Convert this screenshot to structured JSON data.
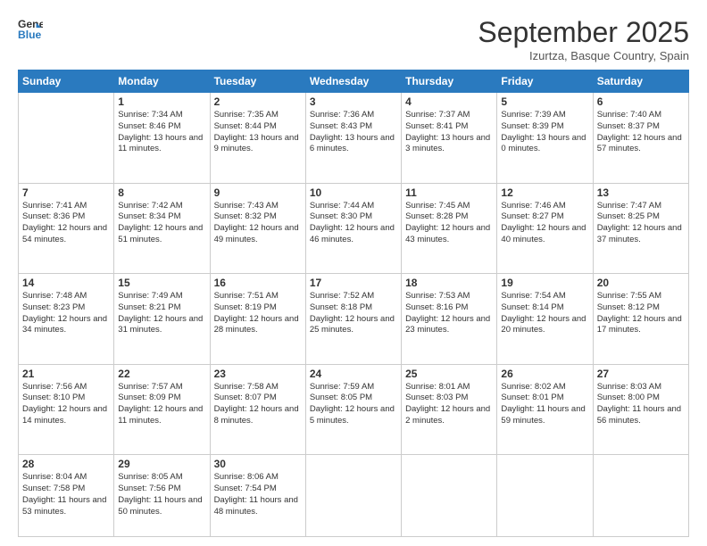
{
  "header": {
    "logo_general": "General",
    "logo_blue": "Blue",
    "month_title": "September 2025",
    "subtitle": "Izurtza, Basque Country, Spain"
  },
  "days_of_week": [
    "Sunday",
    "Monday",
    "Tuesday",
    "Wednesday",
    "Thursday",
    "Friday",
    "Saturday"
  ],
  "weeks": [
    [
      {
        "day": "",
        "sunrise": "",
        "sunset": "",
        "daylight": ""
      },
      {
        "day": "1",
        "sunrise": "Sunrise: 7:34 AM",
        "sunset": "Sunset: 8:46 PM",
        "daylight": "Daylight: 13 hours and 11 minutes."
      },
      {
        "day": "2",
        "sunrise": "Sunrise: 7:35 AM",
        "sunset": "Sunset: 8:44 PM",
        "daylight": "Daylight: 13 hours and 9 minutes."
      },
      {
        "day": "3",
        "sunrise": "Sunrise: 7:36 AM",
        "sunset": "Sunset: 8:43 PM",
        "daylight": "Daylight: 13 hours and 6 minutes."
      },
      {
        "day": "4",
        "sunrise": "Sunrise: 7:37 AM",
        "sunset": "Sunset: 8:41 PM",
        "daylight": "Daylight: 13 hours and 3 minutes."
      },
      {
        "day": "5",
        "sunrise": "Sunrise: 7:39 AM",
        "sunset": "Sunset: 8:39 PM",
        "daylight": "Daylight: 13 hours and 0 minutes."
      },
      {
        "day": "6",
        "sunrise": "Sunrise: 7:40 AM",
        "sunset": "Sunset: 8:37 PM",
        "daylight": "Daylight: 12 hours and 57 minutes."
      }
    ],
    [
      {
        "day": "7",
        "sunrise": "Sunrise: 7:41 AM",
        "sunset": "Sunset: 8:36 PM",
        "daylight": "Daylight: 12 hours and 54 minutes."
      },
      {
        "day": "8",
        "sunrise": "Sunrise: 7:42 AM",
        "sunset": "Sunset: 8:34 PM",
        "daylight": "Daylight: 12 hours and 51 minutes."
      },
      {
        "day": "9",
        "sunrise": "Sunrise: 7:43 AM",
        "sunset": "Sunset: 8:32 PM",
        "daylight": "Daylight: 12 hours and 49 minutes."
      },
      {
        "day": "10",
        "sunrise": "Sunrise: 7:44 AM",
        "sunset": "Sunset: 8:30 PM",
        "daylight": "Daylight: 12 hours and 46 minutes."
      },
      {
        "day": "11",
        "sunrise": "Sunrise: 7:45 AM",
        "sunset": "Sunset: 8:28 PM",
        "daylight": "Daylight: 12 hours and 43 minutes."
      },
      {
        "day": "12",
        "sunrise": "Sunrise: 7:46 AM",
        "sunset": "Sunset: 8:27 PM",
        "daylight": "Daylight: 12 hours and 40 minutes."
      },
      {
        "day": "13",
        "sunrise": "Sunrise: 7:47 AM",
        "sunset": "Sunset: 8:25 PM",
        "daylight": "Daylight: 12 hours and 37 minutes."
      }
    ],
    [
      {
        "day": "14",
        "sunrise": "Sunrise: 7:48 AM",
        "sunset": "Sunset: 8:23 PM",
        "daylight": "Daylight: 12 hours and 34 minutes."
      },
      {
        "day": "15",
        "sunrise": "Sunrise: 7:49 AM",
        "sunset": "Sunset: 8:21 PM",
        "daylight": "Daylight: 12 hours and 31 minutes."
      },
      {
        "day": "16",
        "sunrise": "Sunrise: 7:51 AM",
        "sunset": "Sunset: 8:19 PM",
        "daylight": "Daylight: 12 hours and 28 minutes."
      },
      {
        "day": "17",
        "sunrise": "Sunrise: 7:52 AM",
        "sunset": "Sunset: 8:18 PM",
        "daylight": "Daylight: 12 hours and 25 minutes."
      },
      {
        "day": "18",
        "sunrise": "Sunrise: 7:53 AM",
        "sunset": "Sunset: 8:16 PM",
        "daylight": "Daylight: 12 hours and 23 minutes."
      },
      {
        "day": "19",
        "sunrise": "Sunrise: 7:54 AM",
        "sunset": "Sunset: 8:14 PM",
        "daylight": "Daylight: 12 hours and 20 minutes."
      },
      {
        "day": "20",
        "sunrise": "Sunrise: 7:55 AM",
        "sunset": "Sunset: 8:12 PM",
        "daylight": "Daylight: 12 hours and 17 minutes."
      }
    ],
    [
      {
        "day": "21",
        "sunrise": "Sunrise: 7:56 AM",
        "sunset": "Sunset: 8:10 PM",
        "daylight": "Daylight: 12 hours and 14 minutes."
      },
      {
        "day": "22",
        "sunrise": "Sunrise: 7:57 AM",
        "sunset": "Sunset: 8:09 PM",
        "daylight": "Daylight: 12 hours and 11 minutes."
      },
      {
        "day": "23",
        "sunrise": "Sunrise: 7:58 AM",
        "sunset": "Sunset: 8:07 PM",
        "daylight": "Daylight: 12 hours and 8 minutes."
      },
      {
        "day": "24",
        "sunrise": "Sunrise: 7:59 AM",
        "sunset": "Sunset: 8:05 PM",
        "daylight": "Daylight: 12 hours and 5 minutes."
      },
      {
        "day": "25",
        "sunrise": "Sunrise: 8:01 AM",
        "sunset": "Sunset: 8:03 PM",
        "daylight": "Daylight: 12 hours and 2 minutes."
      },
      {
        "day": "26",
        "sunrise": "Sunrise: 8:02 AM",
        "sunset": "Sunset: 8:01 PM",
        "daylight": "Daylight: 11 hours and 59 minutes."
      },
      {
        "day": "27",
        "sunrise": "Sunrise: 8:03 AM",
        "sunset": "Sunset: 8:00 PM",
        "daylight": "Daylight: 11 hours and 56 minutes."
      }
    ],
    [
      {
        "day": "28",
        "sunrise": "Sunrise: 8:04 AM",
        "sunset": "Sunset: 7:58 PM",
        "daylight": "Daylight: 11 hours and 53 minutes."
      },
      {
        "day": "29",
        "sunrise": "Sunrise: 8:05 AM",
        "sunset": "Sunset: 7:56 PM",
        "daylight": "Daylight: 11 hours and 50 minutes."
      },
      {
        "day": "30",
        "sunrise": "Sunrise: 8:06 AM",
        "sunset": "Sunset: 7:54 PM",
        "daylight": "Daylight: 11 hours and 48 minutes."
      },
      {
        "day": "",
        "sunrise": "",
        "sunset": "",
        "daylight": ""
      },
      {
        "day": "",
        "sunrise": "",
        "sunset": "",
        "daylight": ""
      },
      {
        "day": "",
        "sunrise": "",
        "sunset": "",
        "daylight": ""
      },
      {
        "day": "",
        "sunrise": "",
        "sunset": "",
        "daylight": ""
      }
    ]
  ]
}
